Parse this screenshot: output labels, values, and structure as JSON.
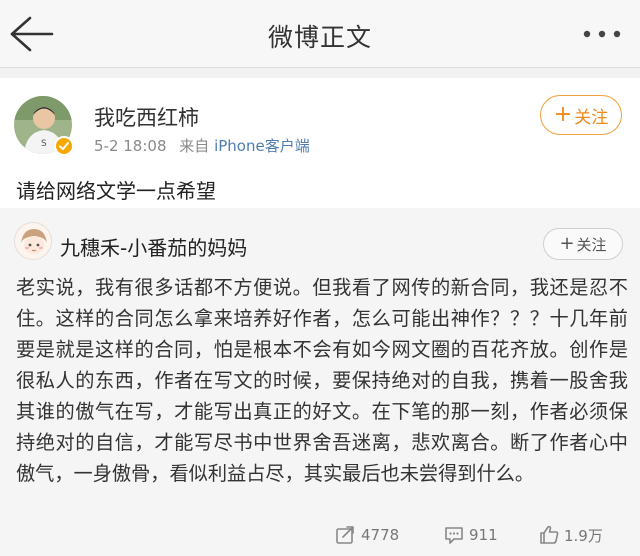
{
  "nav": {
    "title": "微博正文",
    "back_icon": "back-arrow-icon",
    "more_icon": "more-dots-icon"
  },
  "post": {
    "author": "我吃西红柿",
    "time": "5-2 18:08",
    "source_prefix": "来自",
    "source": "iPhone客户端",
    "follow_plus": "+",
    "follow_label": "关注",
    "verified_badge_color": "#f7a800",
    "text": "请给网络文学一点希望"
  },
  "repost": {
    "author": "九穗禾-小番茄的妈妈",
    "follow_plus": "+",
    "follow_label": "关注",
    "text": "老实说，我有很多话都不方便说。但我看了网传的新合同，我还是忍不住。这样的合同怎么拿来培养好作者，怎么可能出神作？？？十几年前要是就是这样的合同，怕是根本不会有如今网文圈的百花齐放。创作是很私人的东西，作者在写文的时候，要保持绝对的自我，携着一股舍我其谁的傲气在写，才能写出真正的好文。在下笔的那一刻，作者必须保持绝对的自信，才能写尽书中世界舍吾迷离，悲欢离合。断了作者心中傲气，一身傲骨，看似利益占尽，其实最后也未尝得到什么。",
    "stats": {
      "reposts": "4778",
      "comments": "911",
      "likes": "1.9万"
    }
  },
  "colors": {
    "accent_orange": "#f08a1c",
    "link_blue": "#507daf"
  }
}
